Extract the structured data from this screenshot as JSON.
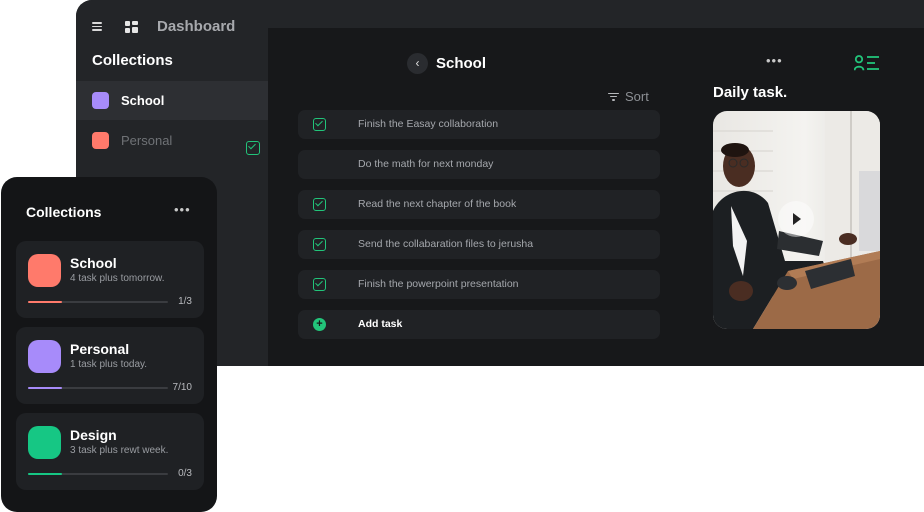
{
  "app": {
    "title": "Dashboard"
  },
  "sidebar": {
    "heading": "Collections",
    "items": [
      {
        "label": "School",
        "color": "#a78bfa"
      },
      {
        "label": "Personal",
        "color": "#ff7a6b"
      }
    ]
  },
  "list": {
    "title": "School",
    "sort_label": "Sort",
    "tasks": [
      {
        "text": "Finish the  Easay collaboration",
        "done": true
      },
      {
        "text": "Do the math for next monday",
        "done": false
      },
      {
        "text": "Read the next chapter of the book",
        "done": true
      },
      {
        "text": "Send the collabaration files to jerusha",
        "done": true
      },
      {
        "text": "Finish the powerpoint presentation",
        "done": true
      }
    ],
    "add_label": "Add task"
  },
  "daily": {
    "title": "Daily task."
  },
  "panel": {
    "title": "Collections",
    "cards": [
      {
        "name": "School",
        "sub": "4 task plus tomorrow.",
        "count": "1/3",
        "progress": 0.24,
        "color": "#ff7a6b"
      },
      {
        "name": "Personal",
        "sub": "1 task plus today.",
        "count": "7/10",
        "progress": 0.24,
        "color": "#a78bfa"
      },
      {
        "name": "Design",
        "sub": "3 task plus rewt week.",
        "count": "0/3",
        "progress": 0.24,
        "color": "#16c784"
      }
    ]
  },
  "colors": {
    "accent": "#22c47a",
    "background": "#17181a"
  }
}
